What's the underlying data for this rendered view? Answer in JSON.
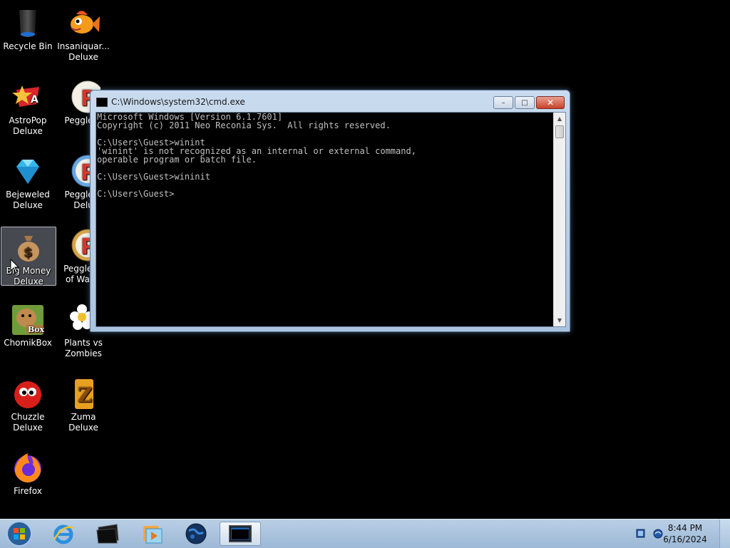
{
  "desktop": {
    "icons": [
      {
        "label": "Recycle Bin",
        "icon": "recycle-bin-icon"
      },
      {
        "label": "Insaniquar...\nDeluxe",
        "icon": "goldfish-icon"
      },
      {
        "label": "AstroPop\nDeluxe",
        "icon": "astropop-icon"
      },
      {
        "label": "Peggle D",
        "icon": "peggle-icon"
      },
      {
        "label": "Bejeweled\nDeluxe",
        "icon": "gem-icon"
      },
      {
        "label": "Peggle N\nDelu",
        "icon": "peggle-icon"
      },
      {
        "label": "Big Money\nDeluxe",
        "icon": "money-bag-icon"
      },
      {
        "label": "Peggle W\nof Warcr",
        "icon": "peggle-icon"
      },
      {
        "label": "ChomikBox",
        "icon": "hamster-icon"
      },
      {
        "label": "Plants vs\nZombies",
        "icon": "flower-icon"
      },
      {
        "label": "Chuzzle\nDeluxe",
        "icon": "chuzzle-icon"
      },
      {
        "label": "Zuma Deluxe",
        "icon": "zuma-icon"
      },
      {
        "label": "Firefox",
        "icon": "firefox-icon"
      }
    ]
  },
  "cmd": {
    "title": "C:\\Windows\\system32\\cmd.exe",
    "lines": [
      "Microsoft Windows [Version 6.1.7601]",
      "Copyright (c) 2011 Neo Reconia Sys.  All rights reserved.",
      "",
      "C:\\Users\\Guest>winint",
      "'winint' is not recognized as an internal or external command,",
      "operable program or batch file.",
      "",
      "C:\\Users\\Guest>wininit",
      "",
      "C:\\Users\\Guest>"
    ],
    "buttons": {
      "minimize": "–",
      "maximize": "□",
      "close": "✕"
    }
  },
  "taskbar": {
    "items": [
      "start-orb-icon",
      "internet-explorer-icon",
      "folder-black-icon",
      "media-player-icon",
      "globe-icon",
      "cmd-icon"
    ],
    "clock_time": "8:44 PM",
    "clock_date": "6/16/2024"
  },
  "colors": {
    "desktop_bg": "#000000",
    "console_text": "#c0c0c0",
    "taskbar": "#a9c2dd"
  }
}
